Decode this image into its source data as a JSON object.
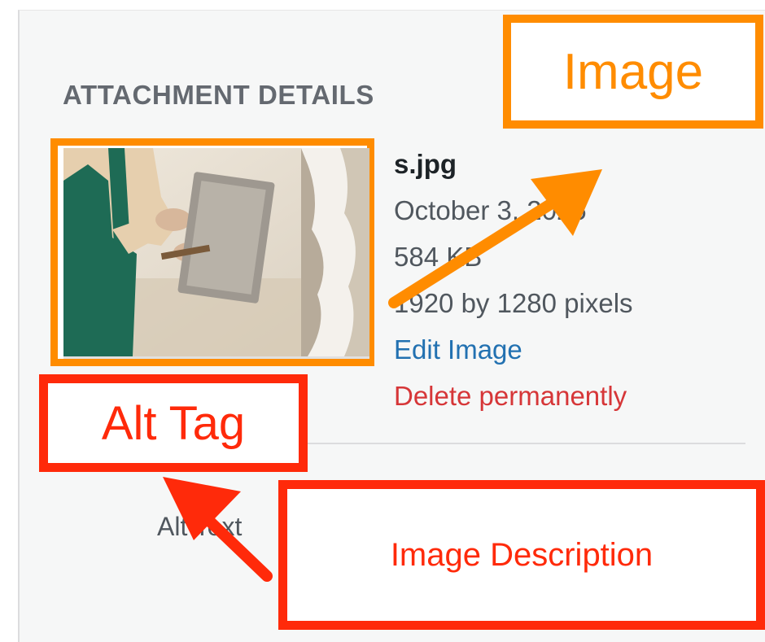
{
  "panel": {
    "heading": "ATTACHMENT DETAILS",
    "thumbnail_icon": "plastering-worker-photo",
    "details": {
      "filename": "s.jpg",
      "date": "October 3, 2025",
      "filesize": "584 KB",
      "dimensions": "1920 by 1280 pixels",
      "edit_link": "Edit Image",
      "delete_link": "Delete permanently"
    },
    "alt_text_label": "Alt Text"
  },
  "annotations": {
    "image": "Image",
    "alt_tag": "Alt Tag",
    "image_description": "Image Description",
    "orange": "#ff8c00",
    "red": "#ff2a0a"
  },
  "colors": {
    "link_blue": "#2271b1",
    "delete_red": "#d63638",
    "panel_bg": "#f6f7f7"
  }
}
